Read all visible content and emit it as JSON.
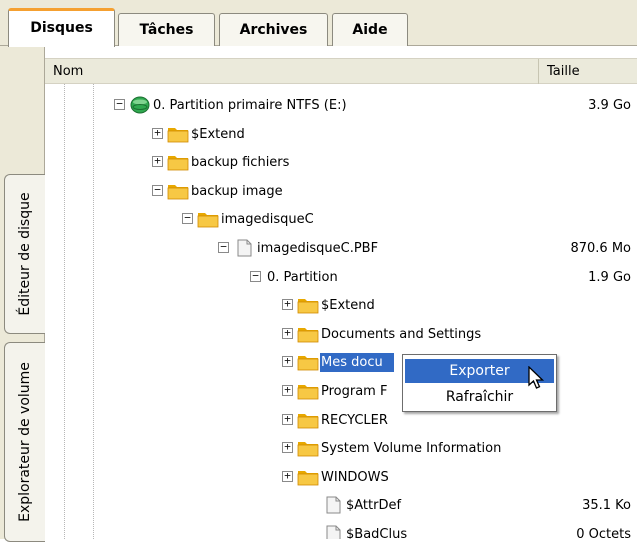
{
  "tabs": [
    {
      "label": "Disques",
      "active": true
    },
    {
      "label": "Tâches",
      "active": false
    },
    {
      "label": "Archives",
      "active": false
    },
    {
      "label": "Aide",
      "active": false
    }
  ],
  "side_tabs": {
    "disk_editor": "Éditeur de disque",
    "volume_explorer": "Explorateur de volume"
  },
  "columns": {
    "name": "Nom",
    "size": "Taille"
  },
  "colors": {
    "selection": "#316ac5",
    "folder": "#f7c844",
    "accent_tab": "#f5a030",
    "chrome": "#ece9d8"
  },
  "tree": [
    {
      "label": "0. Partition primaire NTFS (E:)",
      "size": "3.9 Go",
      "icon": "disk-icon",
      "toggle": "−"
    },
    {
      "label": "$Extend",
      "size": "",
      "icon": "folder-icon",
      "toggle": "+"
    },
    {
      "label": "backup fichiers",
      "size": "",
      "icon": "folder-icon",
      "toggle": "+"
    },
    {
      "label": "backup image",
      "size": "",
      "icon": "folder-icon",
      "toggle": "−"
    },
    {
      "label": "imagedisqueC",
      "size": "",
      "icon": "folder-icon",
      "toggle": "−"
    },
    {
      "label": "imagedisqueC.PBF",
      "size": "870.6 Mo",
      "icon": "file-icon",
      "toggle": "−"
    },
    {
      "label": "0. Partition",
      "size": "1.9 Go",
      "icon": "",
      "toggle": "−"
    },
    {
      "label": "$Extend",
      "size": "",
      "icon": "folder-icon",
      "toggle": "+"
    },
    {
      "label": "Documents and Settings",
      "size": "",
      "icon": "folder-icon",
      "toggle": "+"
    },
    {
      "label": "Mes docu",
      "size": "",
      "icon": "folder-icon",
      "toggle": "+",
      "selected": true
    },
    {
      "label": "Program F",
      "size": "",
      "icon": "folder-icon",
      "toggle": "+"
    },
    {
      "label": "RECYCLER",
      "size": "",
      "icon": "folder-icon",
      "toggle": "+"
    },
    {
      "label": "System Volume Information",
      "size": "",
      "icon": "folder-icon",
      "toggle": "+"
    },
    {
      "label": "WINDOWS",
      "size": "",
      "icon": "folder-icon",
      "toggle": "+"
    },
    {
      "label": "$AttrDef",
      "size": "35.1 Ko",
      "icon": "file-icon",
      "toggle": ""
    },
    {
      "label": "$BadClus",
      "size": "0 Octets",
      "icon": "file-icon",
      "toggle": ""
    }
  ],
  "context_menu": {
    "items": [
      {
        "label": "Exporter",
        "highlighted": true
      },
      {
        "label": "Rafraîchir",
        "highlighted": false
      }
    ]
  }
}
